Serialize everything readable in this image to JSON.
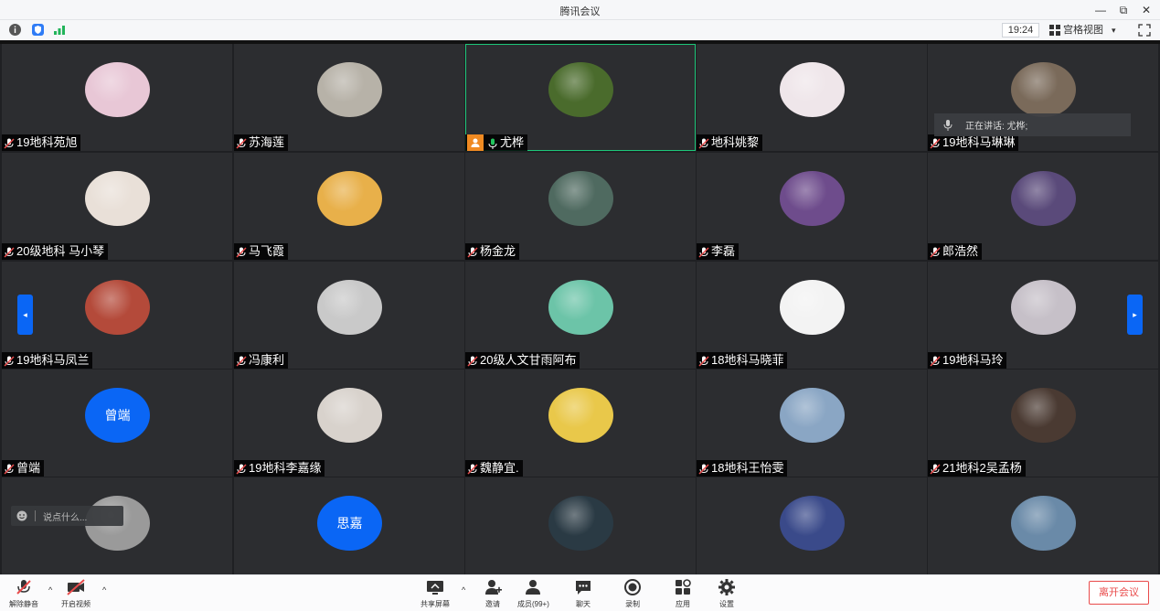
{
  "window": {
    "title": "腾讯会议",
    "minimize": "—",
    "restore": "⧉",
    "close": "✕"
  },
  "infobar": {
    "time": "19:24",
    "view_label": "宫格视图",
    "view_caret": "▾"
  },
  "speaking": {
    "label": "正在讲话: 尤桦;"
  },
  "chat": {
    "placeholder": "说点什么..."
  },
  "nav": {
    "prev": "◂",
    "next": "▸"
  },
  "participants": [
    {
      "name": "19地科苑旭",
      "avatar_color": "#e8c7d6"
    },
    {
      "name": "苏海莲",
      "avatar_color": "#b7b2a8"
    },
    {
      "name": "尤桦",
      "avatar_color": "#4a6b2c",
      "host": true,
      "active": true
    },
    {
      "name": "地科姚黎",
      "avatar_color": "#efe6ea"
    },
    {
      "name": "19地科马琳琳",
      "avatar_color": "#7a6a5a"
    },
    {
      "name": "20级地科 马小琴",
      "avatar_color": "#e9e0d8"
    },
    {
      "name": "马飞霞",
      "avatar_color": "#e8b04a"
    },
    {
      "name": "杨金龙",
      "avatar_color": "#4f6a60"
    },
    {
      "name": "李磊",
      "avatar_color": "#6e4c8c"
    },
    {
      "name": "郎浩然",
      "avatar_color": "#5a4a7a"
    },
    {
      "name": "19地科马凤兰",
      "avatar_color": "#b44a3a"
    },
    {
      "name": "冯康利",
      "avatar_color": "#c9c9c9"
    },
    {
      "name": "20级人文甘雨阿布",
      "avatar_color": "#6cc4a8"
    },
    {
      "name": "18地科马晓菲",
      "avatar_color": "#f3f3f3"
    },
    {
      "name": "19地科马玲",
      "avatar_color": "#c6c0c8"
    },
    {
      "name": "曾端",
      "letter": "曾端"
    },
    {
      "name": "19地科李嘉缘",
      "avatar_color": "#d8d2cc"
    },
    {
      "name": "魏静宜.",
      "avatar_color": "#e9c84a"
    },
    {
      "name": "18地科王怡雯",
      "avatar_color": "#8aa6c4"
    },
    {
      "name": "21地科2吴孟杨",
      "avatar_color": "#4a3a32"
    },
    {
      "name": "",
      "avatar_color": "#9a9a9a"
    },
    {
      "name": "",
      "letter": "思嘉"
    },
    {
      "name": "",
      "avatar_color": "#2a3a44"
    },
    {
      "name": "",
      "avatar_color": "#3a4a8a"
    },
    {
      "name": "",
      "avatar_color": "#6a8aa8"
    }
  ],
  "toolbar": {
    "unmute": "解除静音",
    "video": "开启视频",
    "share": "共享屏幕",
    "invite": "邀请",
    "members": "成员(99+)",
    "chat": "聊天",
    "record": "录制",
    "apps": "应用",
    "settings": "设置",
    "leave": "离开会议",
    "caret": "^"
  },
  "colors": {
    "accent": "#0a66f5",
    "grid_bg": "#2c2d30",
    "active_border": "#1ec77a",
    "host_badge": "#f08a22",
    "leave": "#e94b4b"
  }
}
